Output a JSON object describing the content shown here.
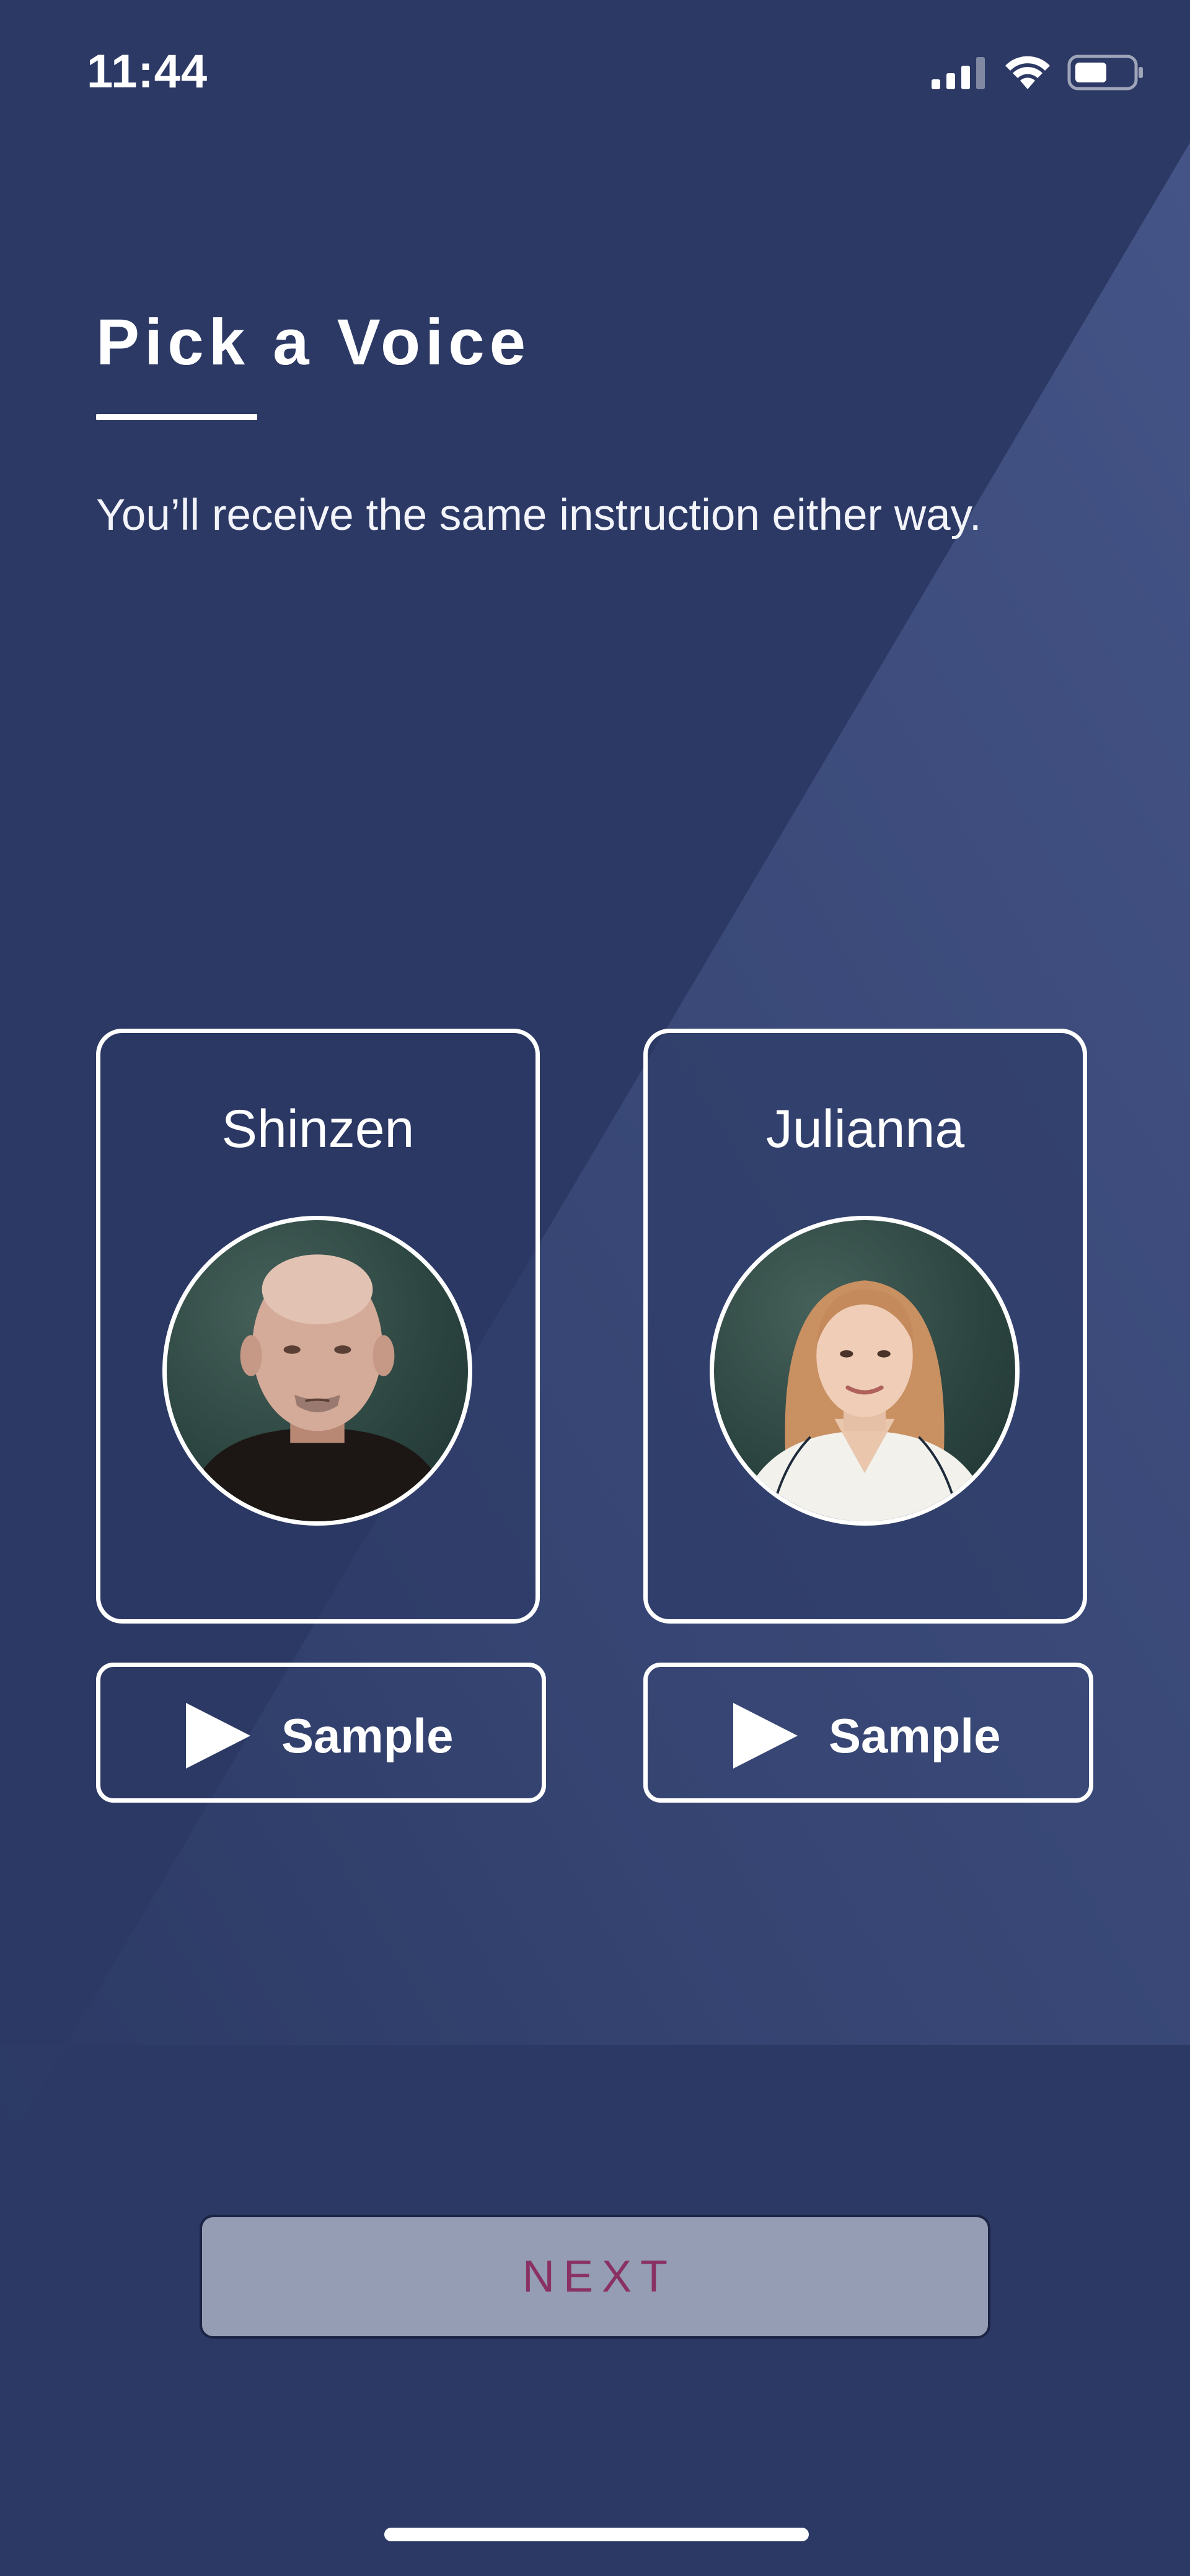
{
  "status_bar": {
    "time": "11:44",
    "icons": [
      "cellular-signal-icon",
      "wifi-icon",
      "battery-icon"
    ]
  },
  "header": {
    "title": "Pick a Voice",
    "subtitle": "You’ll receive the same instruction either way."
  },
  "voices": [
    {
      "name": "Shinzen",
      "avatar": "shinzen-portrait-photo",
      "sample_label": "Sample",
      "sample_icon": "play-icon"
    },
    {
      "name": "Julianna",
      "avatar": "julianna-portrait-photo",
      "sample_label": "Sample",
      "sample_icon": "play-icon"
    }
  ],
  "next_button": {
    "label": "NEXT",
    "state": "disabled"
  },
  "colors": {
    "background": "#2c3965",
    "foreground": "#ffffff",
    "next_button_bg": "#959db4",
    "next_button_text": "#8a3164"
  }
}
